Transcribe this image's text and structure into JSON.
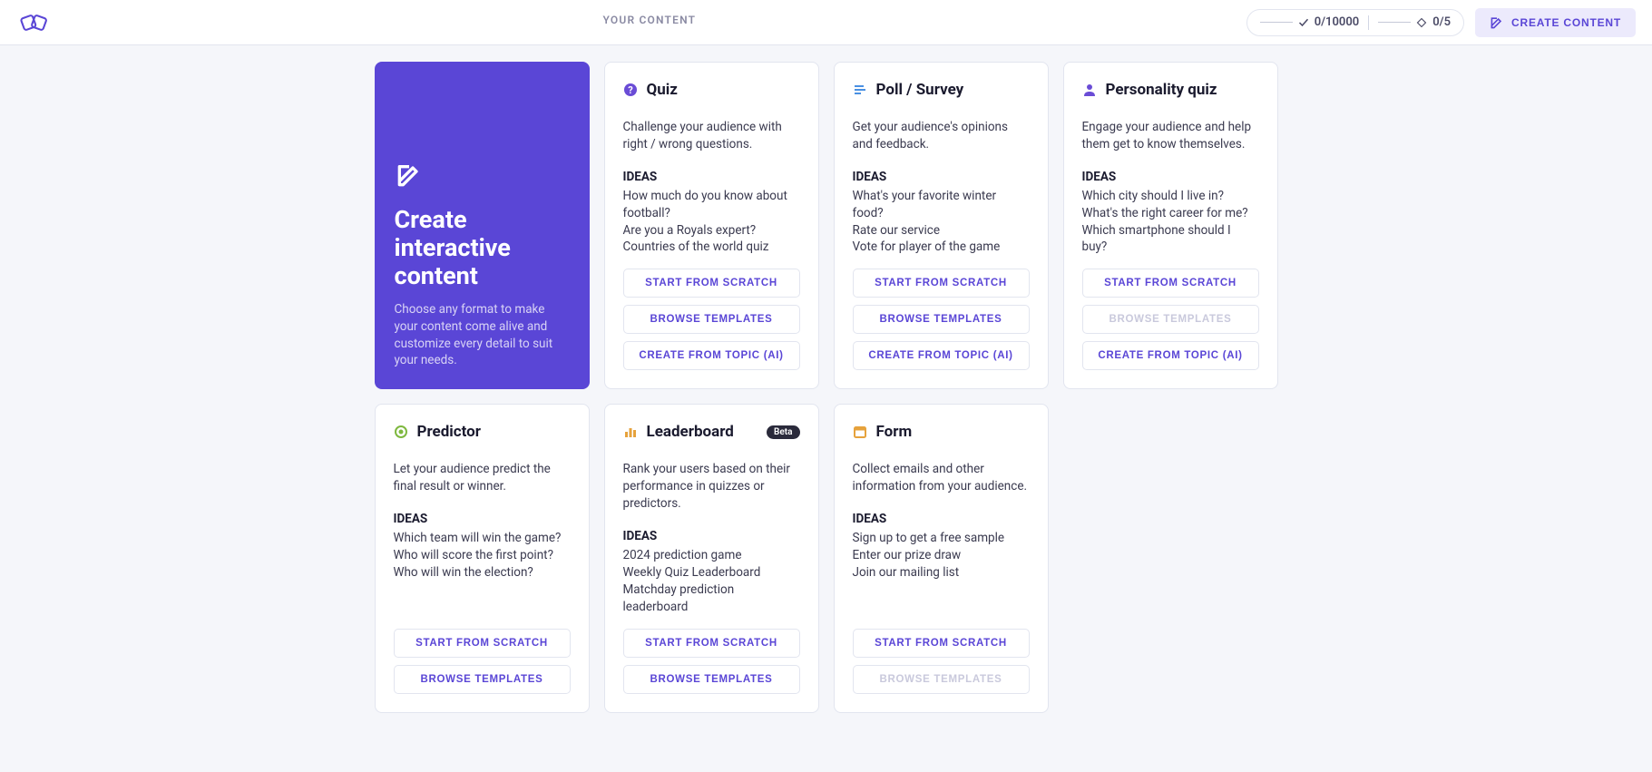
{
  "header": {
    "nav_label": "YOUR CONTENT",
    "counter1": "0/10000",
    "counter2": "0/5",
    "create_label": "CREATE CONTENT"
  },
  "hero": {
    "title": "Create interactive content",
    "desc": "Choose any format to make your content come alive and customize every detail to suit your needs."
  },
  "labels": {
    "ideas": "IDEAS",
    "start_scratch": "START FROM SCRATCH",
    "browse_templates": "BROWSE TEMPLATES",
    "create_ai": "CREATE FROM TOPIC (AI)",
    "beta": "Beta"
  },
  "cards": {
    "quiz": {
      "title": "Quiz",
      "desc": "Challenge your audience with right / wrong questions.",
      "ideas": [
        "How much do you know about football?",
        "Are you a Royals expert?",
        "Countries of the world quiz"
      ]
    },
    "poll": {
      "title": "Poll / Survey",
      "desc": "Get your audience's opinions and feedback.",
      "ideas": [
        "What's your favorite winter food?",
        "Rate our service",
        "Vote for player of the game"
      ]
    },
    "personality": {
      "title": "Personality quiz",
      "desc": "Engage your audience and help them get to know themselves.",
      "ideas": [
        "Which city should I live in?",
        "What's the right career for me?",
        "Which smartphone should I buy?"
      ]
    },
    "predictor": {
      "title": "Predictor",
      "desc": "Let your audience predict the final result or winner.",
      "ideas": [
        "Which team will win the game?",
        "Who will score the first point?",
        "Who will win the election?"
      ]
    },
    "leaderboard": {
      "title": "Leaderboard",
      "desc": "Rank your users based on their performance in quizzes or predictors.",
      "ideas": [
        "2024 prediction game",
        "Weekly Quiz Leaderboard",
        "Matchday prediction leaderboard"
      ]
    },
    "form": {
      "title": "Form",
      "desc": "Collect emails and other information from your audience.",
      "ideas": [
        "Sign up to get a free sample",
        "Enter our prize draw",
        "Join our mailing list"
      ]
    }
  }
}
